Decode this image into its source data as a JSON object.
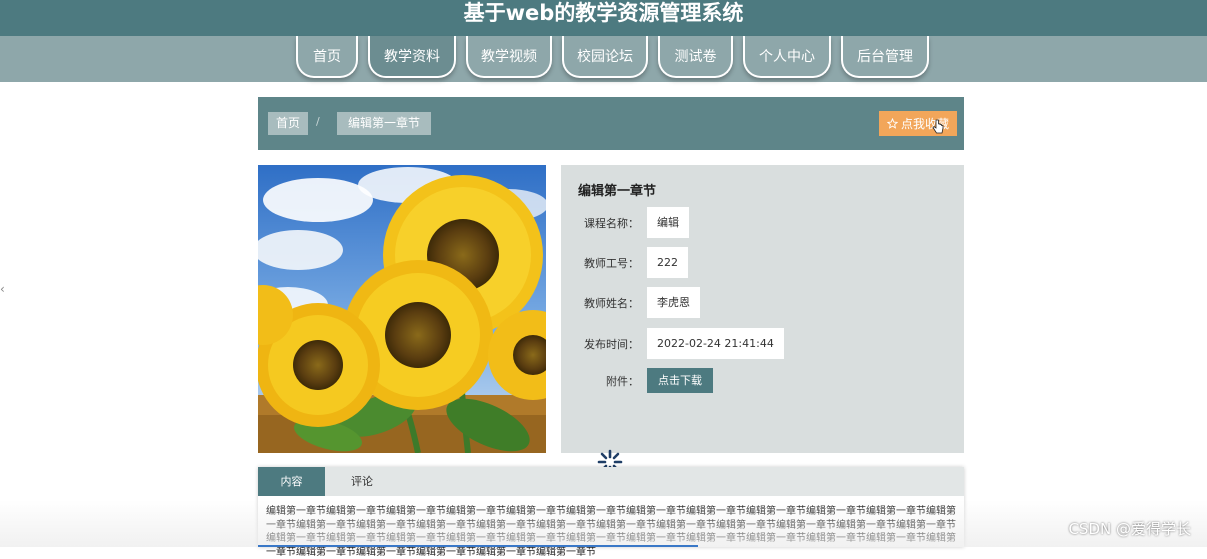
{
  "header": {
    "title": "基于web的教学资源管理系统"
  },
  "nav": {
    "items": [
      {
        "label": "首页"
      },
      {
        "label": "教学资料"
      },
      {
        "label": "教学视频"
      },
      {
        "label": "校园论坛"
      },
      {
        "label": "测试卷"
      },
      {
        "label": "个人中心"
      },
      {
        "label": "后台管理"
      }
    ],
    "active": "教学资料"
  },
  "breadcrumb": {
    "home": "首页",
    "separator": "/",
    "current": "编辑第一章节"
  },
  "favorite": {
    "label": "点我收藏",
    "icon": "star-outline-icon"
  },
  "detail": {
    "title": "编辑第一章节",
    "rows": [
      {
        "label": "课程名称：",
        "value": "编辑"
      },
      {
        "label": "教师工号：",
        "value": "222"
      },
      {
        "label": "教师姓名：",
        "value": "李虎恩"
      },
      {
        "label": "发布时间：",
        "value": "2022-02-24 21:41:44"
      }
    ],
    "attachment_label": "附件：",
    "download_label": "点击下载"
  },
  "tabs": [
    {
      "label": "内容"
    },
    {
      "label": "评论"
    }
  ],
  "content": {
    "text": "编辑第一章节编辑第一章节编辑第一章节编辑第一章节编辑第一章节编辑第一章节编辑第一章节编辑第一章节编辑第一章节编辑第一章节编辑第一章节编辑第一章节编辑第一章节编辑第一章节编辑第一章节编辑第一章节编辑第一章节编辑第一章节编辑第一章节编辑第一章节编辑第一章节编辑第一章节编辑第一章节编辑第一章节编辑第一章节编辑第一章节编辑第一章节编辑第一章节编辑第一章节编辑第一章节编辑第一章节编辑第一章节编辑第一章节编辑第一章节编辑第一章节编辑第一章节编辑第一章节编辑第一章节编辑第一章节编辑第一章节"
  },
  "watermark": "CSDN @爱得学长",
  "colors": {
    "header_bg": "#4d7a80",
    "nav_bg": "#8ea7aa",
    "accent_orange": "#f2a65a",
    "panel_bg": "#d9dede"
  }
}
